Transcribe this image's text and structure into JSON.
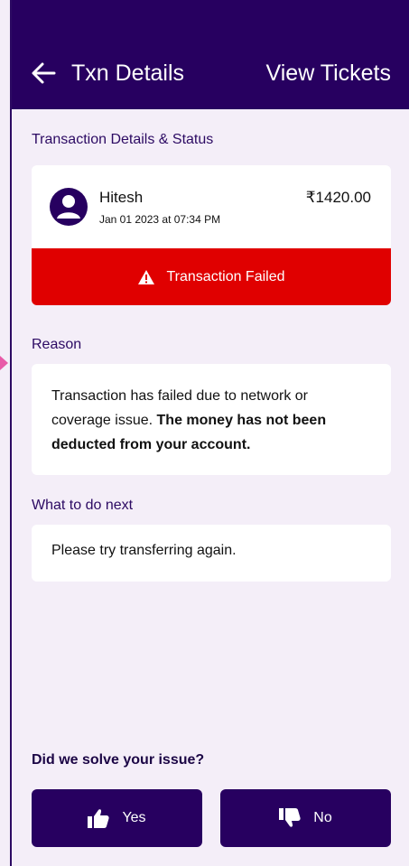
{
  "header": {
    "title": "Txn Details",
    "action": "View Tickets"
  },
  "transaction_section": {
    "label": "Transaction Details & Status",
    "payee": "Hitesh",
    "date": "Jan 01 2023 at 07:34 PM",
    "amount": "₹1420.00",
    "status": "Transaction Failed",
    "status_color": "#e00000"
  },
  "reason_section": {
    "label": "Reason",
    "text_plain": "Transaction has failed due to network or coverage issue. ",
    "text_bold": "The money has not been deducted from your account."
  },
  "next_section": {
    "label": "What to do next",
    "text": "Please try transferring again."
  },
  "feedback": {
    "question": "Did we solve your issue?",
    "yes_label": "Yes",
    "no_label": "No"
  },
  "colors": {
    "brand": "#270060",
    "background": "#f4eef8",
    "error": "#e00000"
  },
  "icons": [
    "back-arrow-icon",
    "avatar-icon",
    "warning-icon",
    "thumbs-up-icon",
    "thumbs-down-icon"
  ]
}
